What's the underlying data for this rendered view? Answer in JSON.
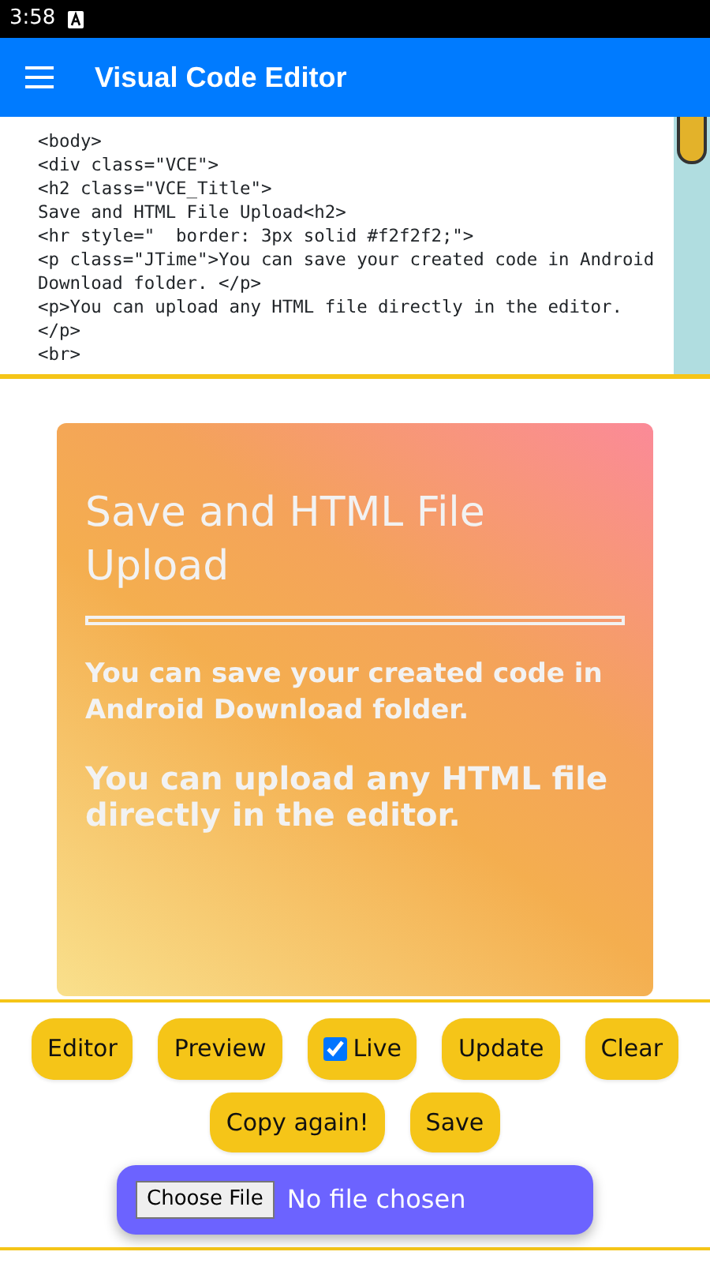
{
  "status_bar": {
    "time": "3:58"
  },
  "app_bar": {
    "title": "Visual Code Editor"
  },
  "editor": {
    "lines": [
      "<body>",
      "<div class=\"VCE\">",
      "<h2 class=\"VCE_Title\">",
      "Save and HTML File Upload<h2>",
      "<hr style=\"  border: 3px solid #f2f2f2;\">",
      "<p class=\"JTime\">You can save your created code in Android Download folder. </p>",
      "<p>You can upload any HTML file directly in the editor.  </p>",
      "<br>"
    ]
  },
  "preview": {
    "title": "Save and HTML File Upload",
    "paragraphs": [
      "You can save your created code in Android Download folder.",
      "You can upload any HTML file directly in the editor."
    ]
  },
  "buttons": [
    {
      "kind": "button",
      "label": "Editor"
    },
    {
      "kind": "button",
      "label": "Preview"
    },
    {
      "kind": "checkbox",
      "label": "Live",
      "checked": true
    },
    {
      "kind": "button",
      "label": "Update"
    },
    {
      "kind": "button",
      "label": "Clear"
    },
    {
      "kind": "break"
    },
    {
      "kind": "button",
      "label": "Copy again!"
    },
    {
      "kind": "button",
      "label": "Save"
    }
  ],
  "file_upload": {
    "button": "Choose File",
    "status": "No file chosen"
  }
}
